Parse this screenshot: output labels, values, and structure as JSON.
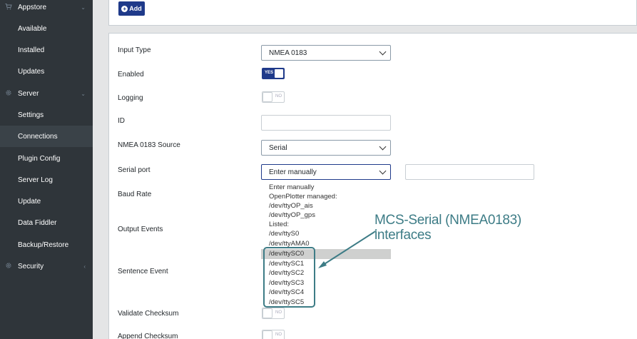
{
  "sidebar": {
    "items": [
      {
        "label": "Appstore",
        "icon": "cart-icon",
        "group": true
      },
      {
        "label": "Available"
      },
      {
        "label": "Installed"
      },
      {
        "label": "Updates"
      },
      {
        "label": "Server",
        "icon": "gear-icon",
        "group": true
      },
      {
        "label": "Settings"
      },
      {
        "label": "Connections",
        "active": true
      },
      {
        "label": "Plugin Config"
      },
      {
        "label": "Server Log"
      },
      {
        "label": "Update"
      },
      {
        "label": "Data Fiddler"
      },
      {
        "label": "Backup/Restore"
      },
      {
        "label": "Security",
        "icon": "gear-icon",
        "group": true
      }
    ]
  },
  "toolbar": {
    "add_label": "Add"
  },
  "form": {
    "input_type_label": "Input Type",
    "input_type_value": "NMEA 0183",
    "enabled_label": "Enabled",
    "enabled_toggle": "YES",
    "logging_label": "Logging",
    "logging_toggle": "NO",
    "id_label": "ID",
    "source_label": "NMEA 0183 Source",
    "source_value": "Serial",
    "serial_port_label": "Serial port",
    "serial_port_value": "Enter manually",
    "baud_rate_label": "Baud Rate",
    "output_events_label": "Output Events",
    "sentence_event_label": "Sentence Event",
    "validate_checksum_label": "Validate Checksum",
    "validate_toggle": "NO",
    "append_checksum_label": "Append Checksum",
    "append_toggle": "NO"
  },
  "dropdown": {
    "options": [
      "Enter manually",
      "OpenPlotter managed:",
      "/dev/ttyOP_ais",
      "/dev/ttyOP_gps",
      "Listed:",
      "/dev/ttyS0",
      "/dev/ttyAMA0",
      "/dev/ttySC0",
      "/dev/ttySC1",
      "/dev/ttySC2",
      "/dev/ttySC3",
      "/dev/ttySC4",
      "/dev/ttySC5"
    ],
    "highlighted_index": 7
  },
  "annotation": {
    "line1": "MCS-Serial (NMEA0183)",
    "line2": "interfaces",
    "color": "#3d7c86"
  }
}
